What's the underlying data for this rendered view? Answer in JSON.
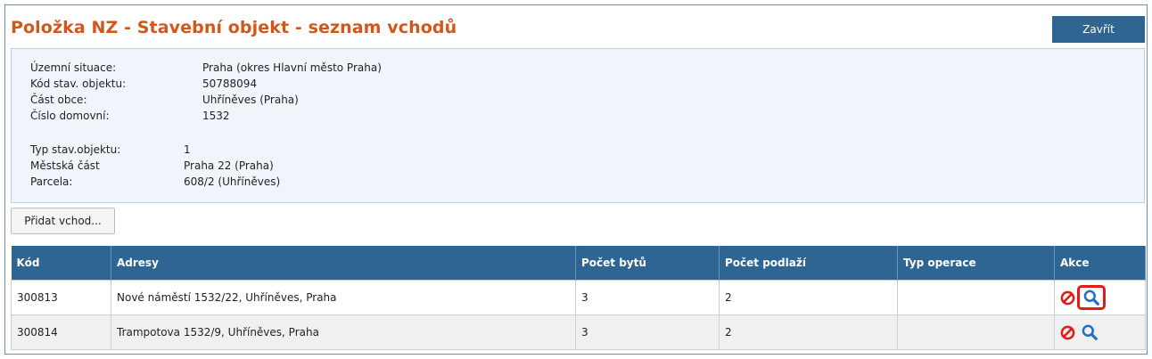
{
  "header": {
    "title": "Položka NZ - Stavební objekt - seznam vchodů",
    "close_label": "Zavřít"
  },
  "info": {
    "block1": [
      {
        "label": "Územní situace:",
        "value": "Praha (okres Hlavní město Praha)"
      },
      {
        "label": "Kód stav. objektu:",
        "value": "50788094"
      },
      {
        "label": "Část obce:",
        "value": "Uhříněves (Praha)"
      },
      {
        "label": "Číslo domovní:",
        "value": "1532"
      }
    ],
    "block2": [
      {
        "label": "Typ stav.objektu:",
        "value": "1"
      },
      {
        "label": "Městská část",
        "value": "Praha 22 (Praha)"
      },
      {
        "label": "Parcela:",
        "value": "608/2 (Uhříněves)"
      }
    ]
  },
  "actions": {
    "add_label": "Přidat vchod..."
  },
  "table": {
    "headers": [
      "Kód",
      "Adresy",
      "Počet bytů",
      "Počet podlaží",
      "Typ operace",
      "Akce"
    ],
    "rows": [
      {
        "kod": "300813",
        "adresy": "Nové náměstí 1532/22, Uhříněves, Praha",
        "byty": "3",
        "podlazi": "2",
        "typ": ""
      },
      {
        "kod": "300814",
        "adresy": "Trampotova 1532/9, Uhříněves, Praha",
        "byty": "3",
        "podlazi": "2",
        "typ": ""
      }
    ]
  },
  "icons": {
    "delete": "ban-icon",
    "detail": "magnifier-icon"
  },
  "colors": {
    "title": "#d2571b",
    "header_bg": "#2f6592",
    "info_bg": "#eff5fa",
    "delete_icon": "#e21b1b",
    "detail_icon": "#1f6fc4",
    "highlight": "#e21b1b"
  }
}
